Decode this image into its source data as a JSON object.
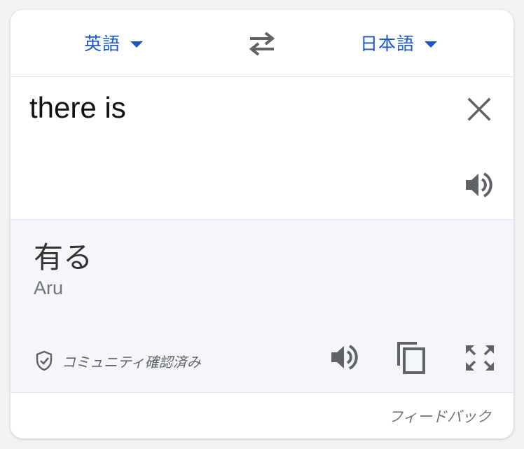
{
  "language_bar": {
    "source_language": "英語",
    "target_language": "日本語",
    "swap_icon": "swap-arrows-icon"
  },
  "input": {
    "text": "there is",
    "clear_icon": "close-icon",
    "speaker_icon": "speaker-icon"
  },
  "output": {
    "translation": "有る",
    "romanization": "Aru",
    "verified_label": "コミュニティ確認済み",
    "verified_icon": "shield-check-icon",
    "tools": [
      "speaker-icon",
      "copy-icon",
      "fullscreen-icon"
    ]
  },
  "footer": {
    "feedback_label": "フィードバック"
  },
  "colors": {
    "accent": "#1a56c7",
    "icon": "#5f6368",
    "output_background": "#f5f6f9"
  }
}
